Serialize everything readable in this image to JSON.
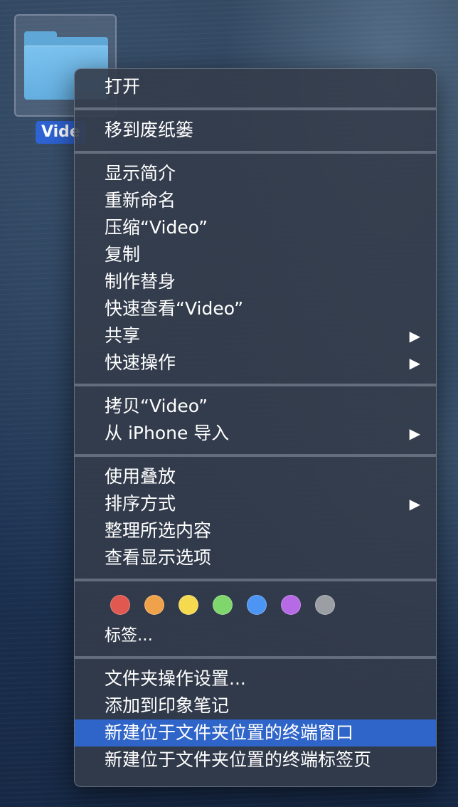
{
  "desktop": {
    "folder_label": "Vide"
  },
  "menu": {
    "open": "打开",
    "trash": "移到废纸篓",
    "get_info": "显示简介",
    "rename": "重新命名",
    "compress": "压缩“Video”",
    "duplicate": "复制",
    "make_alias": "制作替身",
    "quick_look": "快速查看“Video”",
    "share": "共享",
    "quick_actions": "快速操作",
    "copy": "拷贝“Video”",
    "import_from_iphone": "从 iPhone 导入",
    "use_stacks": "使用叠放",
    "sort_by": "排序方式",
    "clean_up_selection": "整理所选内容",
    "show_view_options": "查看显示选项",
    "tags": "标签...",
    "folder_actions_setup": "文件夹操作设置...",
    "add_to_evernote": "添加到印象笔记",
    "new_terminal_at_folder": "新建位于文件夹位置的终端窗口",
    "new_terminal_tab_at_folder": "新建位于文件夹位置的终端标签页",
    "submenu_arrow": "▶"
  },
  "tag_colors": {
    "red": "#e0584f",
    "orange": "#f0a24a",
    "yellow": "#f5d94f",
    "green": "#7fd66c",
    "blue": "#4c95f3",
    "purple": "#b66ae6",
    "gray": "#9b9ea3"
  },
  "highlight_color": "#2f64c8"
}
